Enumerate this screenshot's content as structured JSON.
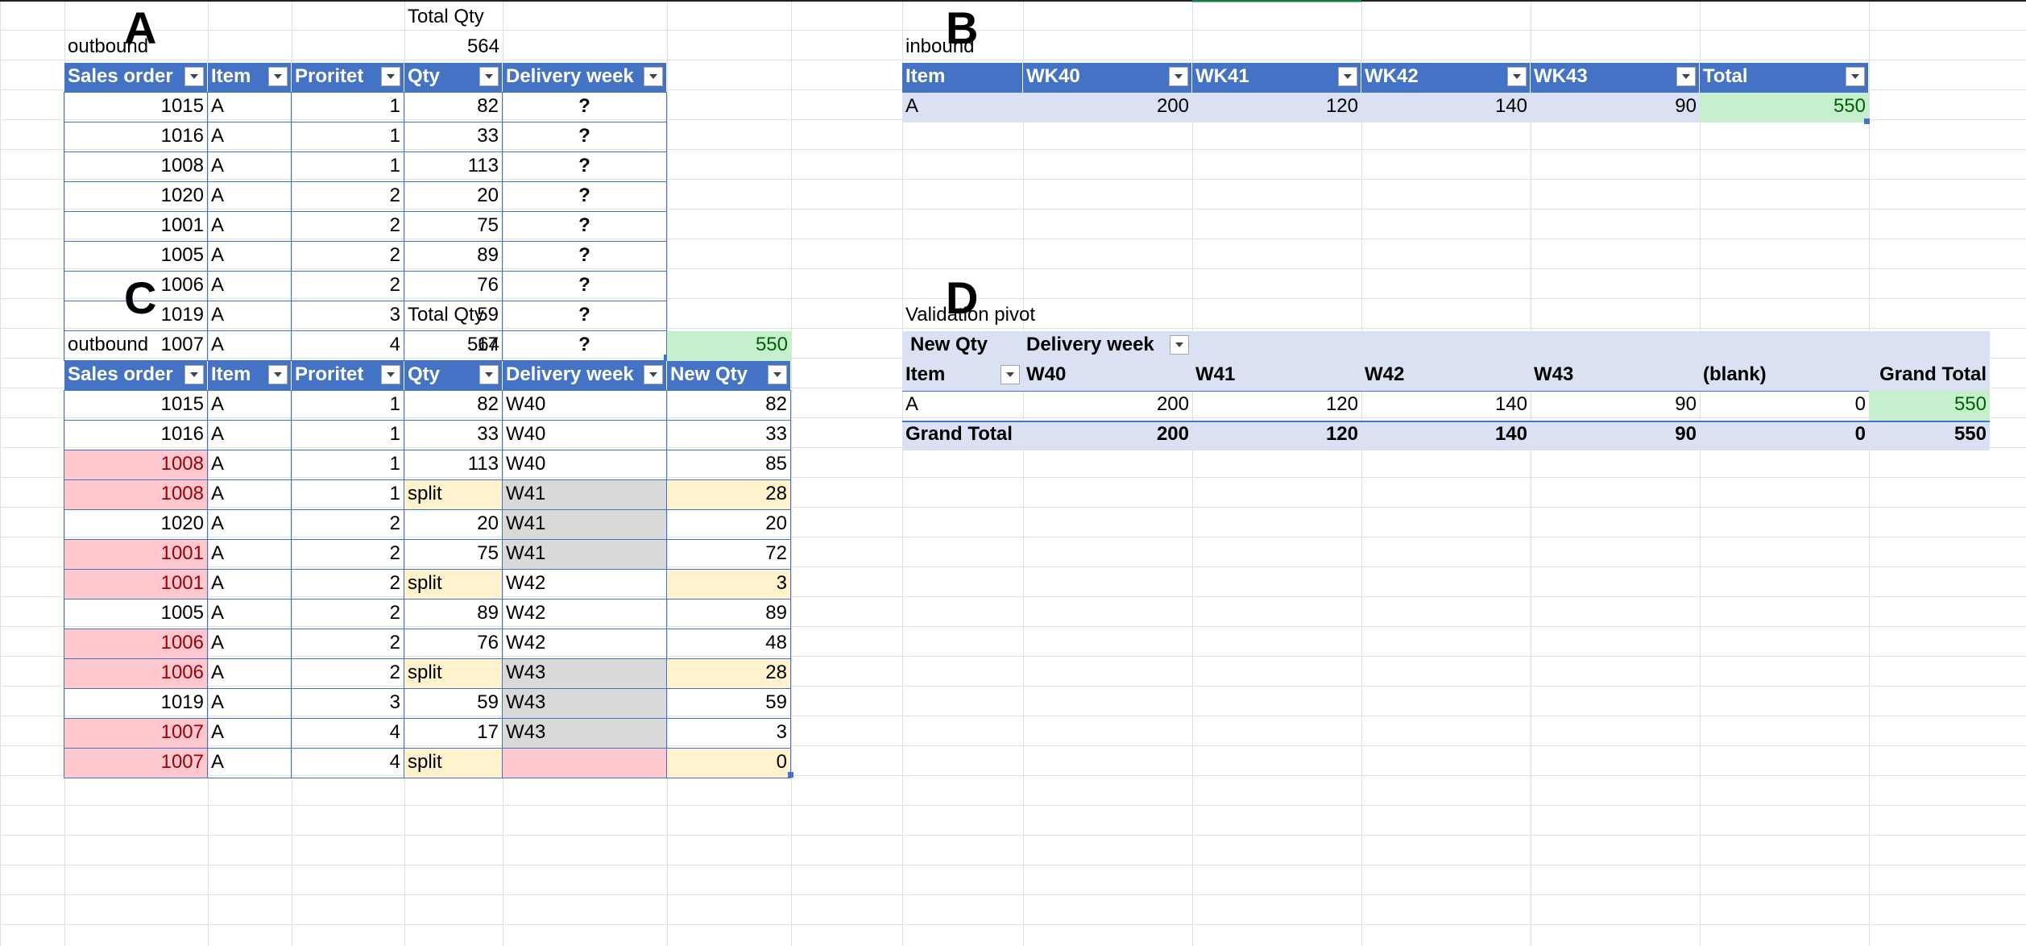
{
  "section_a": {
    "letter": "A",
    "total_qty_label": "Total Qty",
    "outbound_label": "outbound",
    "total_qty_value": "564",
    "headers": [
      "Sales order",
      "Item",
      "Proritet",
      "Qty",
      "Delivery week"
    ],
    "rows": [
      [
        "1015",
        "A",
        "1",
        "82",
        "?"
      ],
      [
        "1016",
        "A",
        "1",
        "33",
        "?"
      ],
      [
        "1008",
        "A",
        "1",
        "113",
        "?"
      ],
      [
        "1020",
        "A",
        "2",
        "20",
        "?"
      ],
      [
        "1001",
        "A",
        "2",
        "75",
        "?"
      ],
      [
        "1005",
        "A",
        "2",
        "89",
        "?"
      ],
      [
        "1006",
        "A",
        "2",
        "76",
        "?"
      ],
      [
        "1019",
        "A",
        "3",
        "59",
        "?"
      ],
      [
        "1007",
        "A",
        "4",
        "17",
        "?"
      ]
    ]
  },
  "section_b": {
    "letter": "B",
    "inbound_label": "inbound",
    "headers": [
      "Item",
      "WK40",
      "WK41",
      "WK42",
      "WK43",
      "Total"
    ],
    "rows": [
      [
        "A",
        "200",
        "120",
        "140",
        "90",
        "550"
      ]
    ]
  },
  "section_c": {
    "letter": "C",
    "total_qty_label": "Total Qty",
    "outbound_label": "outbound",
    "total_qty_value": "564",
    "check_value": "550",
    "headers": [
      "Sales order",
      "Item",
      "Proritet",
      "Qty",
      "Delivery week",
      "New Qty"
    ],
    "rows": [
      {
        "cells": [
          "1015",
          "A",
          "1",
          "82",
          "W40",
          "82"
        ],
        "flags": ""
      },
      {
        "cells": [
          "1016",
          "A",
          "1",
          "33",
          "W40",
          "33"
        ],
        "flags": ""
      },
      {
        "cells": [
          "1008",
          "A",
          "1",
          "113",
          "W40",
          "85"
        ],
        "flags": "red"
      },
      {
        "cells": [
          "1008",
          "A",
          "1",
          "split",
          "W41",
          "28"
        ],
        "flags": "red split grey"
      },
      {
        "cells": [
          "1020",
          "A",
          "2",
          "20",
          "W41",
          "20"
        ],
        "flags": "grey"
      },
      {
        "cells": [
          "1001",
          "A",
          "2",
          "75",
          "W41",
          "72"
        ],
        "flags": "red grey"
      },
      {
        "cells": [
          "1001",
          "A",
          "2",
          "split",
          "W42",
          "3"
        ],
        "flags": "red split"
      },
      {
        "cells": [
          "1005",
          "A",
          "2",
          "89",
          "W42",
          "89"
        ],
        "flags": ""
      },
      {
        "cells": [
          "1006",
          "A",
          "2",
          "76",
          "W42",
          "48"
        ],
        "flags": "red"
      },
      {
        "cells": [
          "1006",
          "A",
          "2",
          "split",
          "W43",
          "28"
        ],
        "flags": "red split grey"
      },
      {
        "cells": [
          "1019",
          "A",
          "3",
          "59",
          "W43",
          "59"
        ],
        "flags": "grey"
      },
      {
        "cells": [
          "1007",
          "A",
          "4",
          "17",
          "W43",
          "3"
        ],
        "flags": "red grey"
      },
      {
        "cells": [
          "1007",
          "A",
          "4",
          "split",
          "",
          "0"
        ],
        "flags": "red split pinkweek"
      }
    ]
  },
  "section_d": {
    "letter": "D",
    "title": "Validation pivot",
    "value_field": "New Qty",
    "column_field": "Delivery week",
    "row_field": "Item",
    "columns": [
      "W40",
      "W41",
      "W42",
      "W43",
      "(blank)",
      "Grand Total"
    ],
    "rows": [
      [
        "A",
        "200",
        "120",
        "140",
        "90",
        "0",
        "550"
      ]
    ],
    "grand_total": [
      "Grand Total",
      "200",
      "120",
      "140",
      "90",
      "0",
      "550"
    ]
  },
  "colors": {
    "table_header": "#4472c4",
    "table_border": "#4472c4",
    "row_band": "#d9e1f2",
    "green_fill": "#c6efce",
    "green_text": "#006100",
    "red_fill": "#ffc7ce",
    "red_text": "#9c0006",
    "yellow_fill": "#fff2cc",
    "grey_fill": "#d9d9d9",
    "gridline": "#e0e0e0"
  }
}
